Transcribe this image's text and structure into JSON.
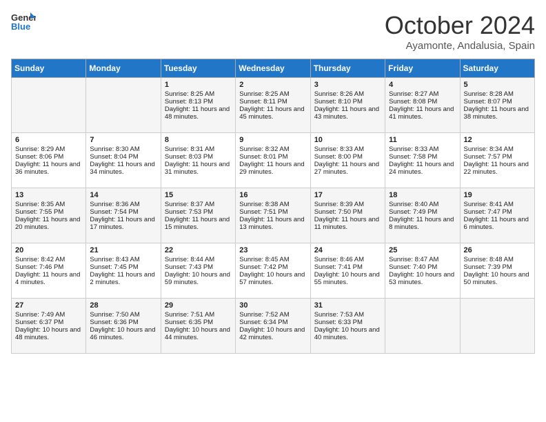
{
  "header": {
    "logo_general": "General",
    "logo_blue": "Blue",
    "month_title": "October 2024",
    "subtitle": "Ayamonte, Andalusia, Spain"
  },
  "calendar": {
    "days_of_week": [
      "Sunday",
      "Monday",
      "Tuesday",
      "Wednesday",
      "Thursday",
      "Friday",
      "Saturday"
    ],
    "weeks": [
      [
        {
          "day": "",
          "sunrise": "",
          "sunset": "",
          "daylight": ""
        },
        {
          "day": "",
          "sunrise": "",
          "sunset": "",
          "daylight": ""
        },
        {
          "day": "1",
          "sunrise": "Sunrise: 8:25 AM",
          "sunset": "Sunset: 8:13 PM",
          "daylight": "Daylight: 11 hours and 48 minutes."
        },
        {
          "day": "2",
          "sunrise": "Sunrise: 8:25 AM",
          "sunset": "Sunset: 8:11 PM",
          "daylight": "Daylight: 11 hours and 45 minutes."
        },
        {
          "day": "3",
          "sunrise": "Sunrise: 8:26 AM",
          "sunset": "Sunset: 8:10 PM",
          "daylight": "Daylight: 11 hours and 43 minutes."
        },
        {
          "day": "4",
          "sunrise": "Sunrise: 8:27 AM",
          "sunset": "Sunset: 8:08 PM",
          "daylight": "Daylight: 11 hours and 41 minutes."
        },
        {
          "day": "5",
          "sunrise": "Sunrise: 8:28 AM",
          "sunset": "Sunset: 8:07 PM",
          "daylight": "Daylight: 11 hours and 38 minutes."
        }
      ],
      [
        {
          "day": "6",
          "sunrise": "Sunrise: 8:29 AM",
          "sunset": "Sunset: 8:06 PM",
          "daylight": "Daylight: 11 hours and 36 minutes."
        },
        {
          "day": "7",
          "sunrise": "Sunrise: 8:30 AM",
          "sunset": "Sunset: 8:04 PM",
          "daylight": "Daylight: 11 hours and 34 minutes."
        },
        {
          "day": "8",
          "sunrise": "Sunrise: 8:31 AM",
          "sunset": "Sunset: 8:03 PM",
          "daylight": "Daylight: 11 hours and 31 minutes."
        },
        {
          "day": "9",
          "sunrise": "Sunrise: 8:32 AM",
          "sunset": "Sunset: 8:01 PM",
          "daylight": "Daylight: 11 hours and 29 minutes."
        },
        {
          "day": "10",
          "sunrise": "Sunrise: 8:33 AM",
          "sunset": "Sunset: 8:00 PM",
          "daylight": "Daylight: 11 hours and 27 minutes."
        },
        {
          "day": "11",
          "sunrise": "Sunrise: 8:33 AM",
          "sunset": "Sunset: 7:58 PM",
          "daylight": "Daylight: 11 hours and 24 minutes."
        },
        {
          "day": "12",
          "sunrise": "Sunrise: 8:34 AM",
          "sunset": "Sunset: 7:57 PM",
          "daylight": "Daylight: 11 hours and 22 minutes."
        }
      ],
      [
        {
          "day": "13",
          "sunrise": "Sunrise: 8:35 AM",
          "sunset": "Sunset: 7:55 PM",
          "daylight": "Daylight: 11 hours and 20 minutes."
        },
        {
          "day": "14",
          "sunrise": "Sunrise: 8:36 AM",
          "sunset": "Sunset: 7:54 PM",
          "daylight": "Daylight: 11 hours and 17 minutes."
        },
        {
          "day": "15",
          "sunrise": "Sunrise: 8:37 AM",
          "sunset": "Sunset: 7:53 PM",
          "daylight": "Daylight: 11 hours and 15 minutes."
        },
        {
          "day": "16",
          "sunrise": "Sunrise: 8:38 AM",
          "sunset": "Sunset: 7:51 PM",
          "daylight": "Daylight: 11 hours and 13 minutes."
        },
        {
          "day": "17",
          "sunrise": "Sunrise: 8:39 AM",
          "sunset": "Sunset: 7:50 PM",
          "daylight": "Daylight: 11 hours and 11 minutes."
        },
        {
          "day": "18",
          "sunrise": "Sunrise: 8:40 AM",
          "sunset": "Sunset: 7:49 PM",
          "daylight": "Daylight: 11 hours and 8 minutes."
        },
        {
          "day": "19",
          "sunrise": "Sunrise: 8:41 AM",
          "sunset": "Sunset: 7:47 PM",
          "daylight": "Daylight: 11 hours and 6 minutes."
        }
      ],
      [
        {
          "day": "20",
          "sunrise": "Sunrise: 8:42 AM",
          "sunset": "Sunset: 7:46 PM",
          "daylight": "Daylight: 11 hours and 4 minutes."
        },
        {
          "day": "21",
          "sunrise": "Sunrise: 8:43 AM",
          "sunset": "Sunset: 7:45 PM",
          "daylight": "Daylight: 11 hours and 2 minutes."
        },
        {
          "day": "22",
          "sunrise": "Sunrise: 8:44 AM",
          "sunset": "Sunset: 7:43 PM",
          "daylight": "Daylight: 10 hours and 59 minutes."
        },
        {
          "day": "23",
          "sunrise": "Sunrise: 8:45 AM",
          "sunset": "Sunset: 7:42 PM",
          "daylight": "Daylight: 10 hours and 57 minutes."
        },
        {
          "day": "24",
          "sunrise": "Sunrise: 8:46 AM",
          "sunset": "Sunset: 7:41 PM",
          "daylight": "Daylight: 10 hours and 55 minutes."
        },
        {
          "day": "25",
          "sunrise": "Sunrise: 8:47 AM",
          "sunset": "Sunset: 7:40 PM",
          "daylight": "Daylight: 10 hours and 53 minutes."
        },
        {
          "day": "26",
          "sunrise": "Sunrise: 8:48 AM",
          "sunset": "Sunset: 7:39 PM",
          "daylight": "Daylight: 10 hours and 50 minutes."
        }
      ],
      [
        {
          "day": "27",
          "sunrise": "Sunrise: 7:49 AM",
          "sunset": "Sunset: 6:37 PM",
          "daylight": "Daylight: 10 hours and 48 minutes."
        },
        {
          "day": "28",
          "sunrise": "Sunrise: 7:50 AM",
          "sunset": "Sunset: 6:36 PM",
          "daylight": "Daylight: 10 hours and 46 minutes."
        },
        {
          "day": "29",
          "sunrise": "Sunrise: 7:51 AM",
          "sunset": "Sunset: 6:35 PM",
          "daylight": "Daylight: 10 hours and 44 minutes."
        },
        {
          "day": "30",
          "sunrise": "Sunrise: 7:52 AM",
          "sunset": "Sunset: 6:34 PM",
          "daylight": "Daylight: 10 hours and 42 minutes."
        },
        {
          "day": "31",
          "sunrise": "Sunrise: 7:53 AM",
          "sunset": "Sunset: 6:33 PM",
          "daylight": "Daylight: 10 hours and 40 minutes."
        },
        {
          "day": "",
          "sunrise": "",
          "sunset": "",
          "daylight": ""
        },
        {
          "day": "",
          "sunrise": "",
          "sunset": "",
          "daylight": ""
        }
      ]
    ]
  }
}
